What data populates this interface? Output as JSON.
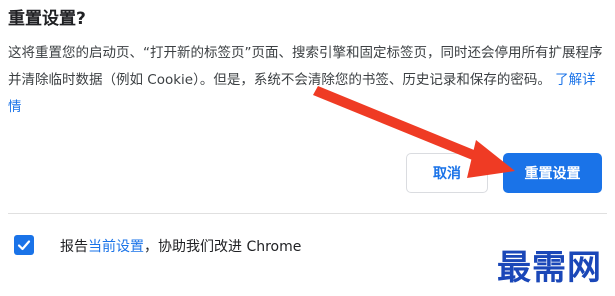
{
  "dialog": {
    "title": "重置设置?",
    "description_text": "这将重置您的启动页、“打开新的标签页”页面、搜索引擎和固定标签页，同时还会停用所有扩展程序并清除临时数据（例如 Cookie）。但是，系统不会清除您的书签、历史记录和保存的密码。",
    "learn_more_link": "了解详情",
    "cancel_label": "取消",
    "reset_label": "重置设置"
  },
  "report": {
    "checked": true,
    "prefix": "报告",
    "link": "当前设置",
    "suffix": "，协助我们改进 Chrome"
  },
  "watermark": {
    "text": "最需网"
  },
  "annotation": {
    "color": "#ef3b24",
    "icon": "red-arrow-pointing-to-reset-button"
  },
  "colors": {
    "accent": "#1a73e8",
    "text": "#202124"
  }
}
